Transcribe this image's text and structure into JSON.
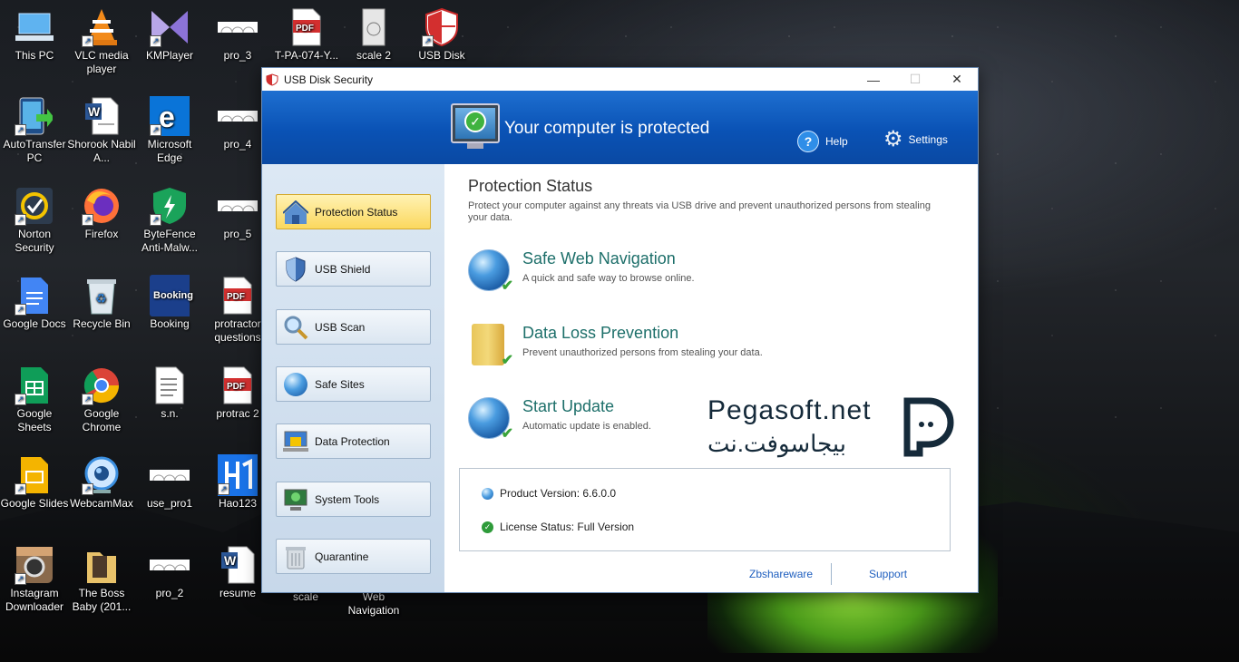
{
  "desktop": {
    "icons": [
      {
        "label": "This PC"
      },
      {
        "label": "VLC media player"
      },
      {
        "label": "KMPlayer"
      },
      {
        "label": "pro_3"
      },
      {
        "label": "T-PA-074-Y..."
      },
      {
        "label": "scale 2"
      },
      {
        "label": "USB Disk"
      },
      {
        "label": "AutoTransfer PC"
      },
      {
        "label": "Shorook Nabil A..."
      },
      {
        "label": "Microsoft Edge"
      },
      {
        "label": "pro_4"
      },
      {
        "label": "Norton Security"
      },
      {
        "label": "Firefox"
      },
      {
        "label": "ByteFence Anti-Malw..."
      },
      {
        "label": "pro_5"
      },
      {
        "label": "Google Docs"
      },
      {
        "label": "Recycle Bin"
      },
      {
        "label": "Booking"
      },
      {
        "label": "protractor questions"
      },
      {
        "label": "Google Sheets"
      },
      {
        "label": "Google Chrome"
      },
      {
        "label": "s.n."
      },
      {
        "label": "protrac 2"
      },
      {
        "label": "Google Slides"
      },
      {
        "label": "WebcamMax"
      },
      {
        "label": "use_pro1"
      },
      {
        "label": "Hao123"
      },
      {
        "label": "Instagram Downloader"
      },
      {
        "label": "The Boss Baby (201..."
      },
      {
        "label": "pro_2"
      },
      {
        "label": "resume"
      },
      {
        "label": "scale"
      },
      {
        "label": "Web Navigation"
      }
    ],
    "booking_icon_text": "Booking",
    "pdf_icon_text": "PDF"
  },
  "window": {
    "title": "USB Disk Security",
    "minimize": "—",
    "maximize": "☐",
    "close": "✕"
  },
  "header": {
    "status": "Your computer is protected",
    "help": "Help",
    "settings": "Settings"
  },
  "sidebar": {
    "items": [
      {
        "label": "Protection Status",
        "icon": "house-shield-icon"
      },
      {
        "label": "USB Shield",
        "icon": "shield-icon"
      },
      {
        "label": "USB Scan",
        "icon": "magnifier-icon"
      },
      {
        "label": "Safe Sites",
        "icon": "globe-icon"
      },
      {
        "label": "Data Protection",
        "icon": "data-protection-icon"
      },
      {
        "label": "System Tools",
        "icon": "monitor-tools-icon"
      },
      {
        "label": "Quarantine",
        "icon": "trash-bin-icon"
      }
    ],
    "active_index": 0
  },
  "main": {
    "title": "Protection Status",
    "description": "Protect your computer against any threats via USB drive and prevent unauthorized persons from stealing your data.",
    "features": [
      {
        "name": "Safe Web Navigation",
        "desc": "A quick and safe way to browse online."
      },
      {
        "name": "Data Loss Prevention",
        "desc": "Prevent unauthorized persons from stealing your data."
      },
      {
        "name": "Start Update",
        "desc": "Automatic update is enabled."
      }
    ],
    "product_version": "Product Version: 6.6.0.0",
    "license_status": "License Status: Full Version",
    "link_left": "Zbshareware",
    "link_right": "Support"
  },
  "watermark": {
    "latin": "Pegasoft.net",
    "arabic": "بيجاسوفت.نت"
  },
  "colors": {
    "header_blue": "#0a52b5",
    "active_nav": "#fbd85e",
    "feature_title": "#1d6f6a",
    "link": "#1f5fbf"
  }
}
